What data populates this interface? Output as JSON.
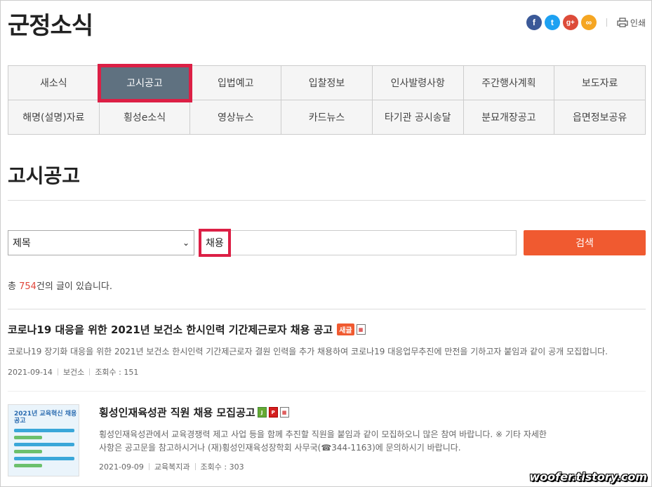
{
  "header": {
    "site_title": "군정소식",
    "print_label": "인쇄"
  },
  "share": [
    {
      "icon": "facebook-icon",
      "glyph": "f",
      "color": "#3b5998"
    },
    {
      "icon": "twitter-icon",
      "glyph": "t",
      "color": "#1da1f2"
    },
    {
      "icon": "googleplus-icon",
      "glyph": "g+",
      "color": "#dd4b39"
    },
    {
      "icon": "link-icon",
      "glyph": "∞",
      "color": "#f5a623"
    }
  ],
  "nav": {
    "items": [
      {
        "label": "새소식"
      },
      {
        "label": "고시공고",
        "active": true
      },
      {
        "label": "입법예고"
      },
      {
        "label": "입찰정보"
      },
      {
        "label": "인사발령사항"
      },
      {
        "label": "주간행사계획"
      },
      {
        "label": "보도자료"
      },
      {
        "label": "해명(설명)자료"
      },
      {
        "label": "횡성e소식"
      },
      {
        "label": "영상뉴스"
      },
      {
        "label": "카드뉴스"
      },
      {
        "label": "타기관 공시송달"
      },
      {
        "label": "분묘개장공고"
      },
      {
        "label": "읍면정보공유"
      }
    ]
  },
  "page": {
    "title": "고시공고"
  },
  "search": {
    "field_selected": "제목",
    "query": "채용",
    "button_label": "검색"
  },
  "count": {
    "prefix": "총 ",
    "number": "754",
    "suffix": "건의 글이 있습니다."
  },
  "posts": [
    {
      "title": "코로나19 대응을 위한 2021년 보건소 한시인력 기간제근로자 채용 공고",
      "badge": "새글",
      "desc": "코로나19 장기화 대응을 위한 2021년 보건소 한시인력 기간제근로자 결원 인력을 추가 채용하여 코로나19 대응업무추진에 만전을 기하고자 붙임과 같이 공개 모집합니다.",
      "date": "2021-09-14",
      "dept": "보건소",
      "views": "조회수 : 151"
    },
    {
      "title": "횡성인재육성관 직원 채용 모집공고",
      "desc": "횡성인재육성관에서 교육경쟁력 제고 사업 등을 함께 추진할 직원을 붙임과 같이 모집하오니 많은 참여 바랍니다. ※ 기타 자세한 사항은 공고문을 참고하시거나 (재)횡성인재육성장학회 사무국(☎344-1163)에 문의하시기 바랍니다.",
      "date": "2021-09-09",
      "dept": "교육복지과",
      "views": "조회수 : 303",
      "thumb_text": "2021년 교육혁신 채용공고"
    }
  ],
  "watermark": "woofer.tistory.com"
}
